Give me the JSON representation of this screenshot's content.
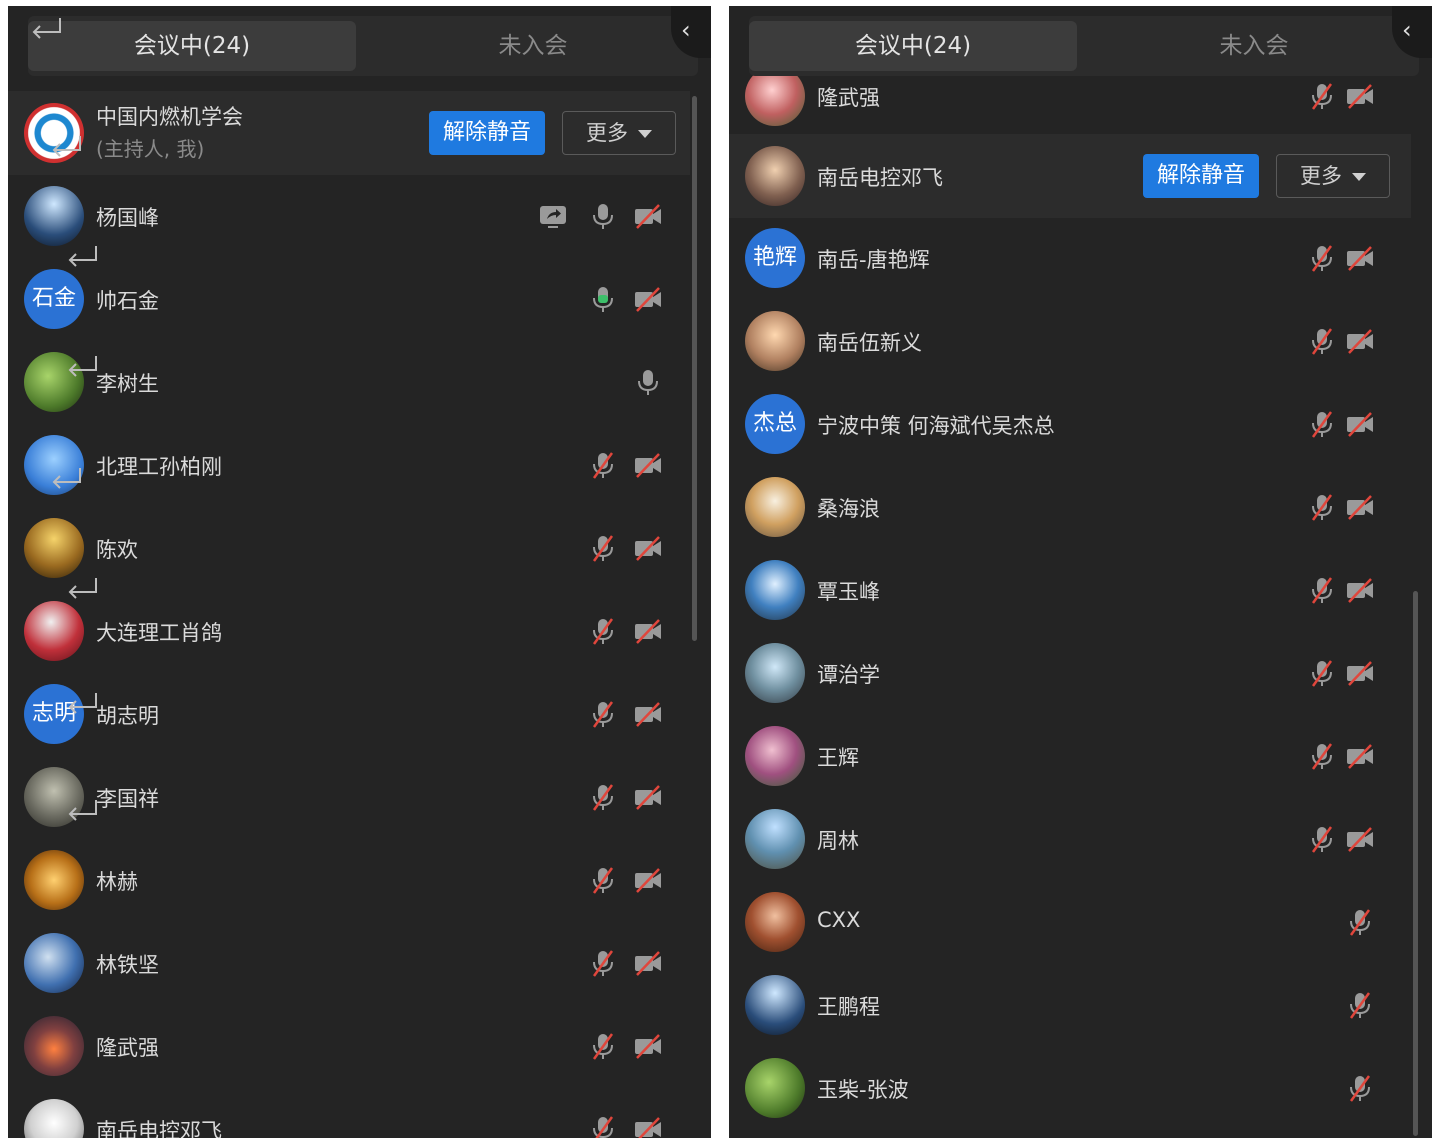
{
  "left_panel": {
    "tabs": [
      {
        "label": "会议中(24)"
      },
      {
        "label": "未入会"
      }
    ],
    "collapse_glyph": "‹",
    "host_row": {
      "name": "中国内燃机学会",
      "role": "(主持人, 我)",
      "unmute_label": "解除静音",
      "more_label": "更多"
    },
    "participants": [
      {
        "name": "杨国峰",
        "mic": "normal",
        "cam": "off",
        "share": true
      },
      {
        "name": "帅石金",
        "avatar_text": "石金",
        "mic": "speaking",
        "cam": "off"
      },
      {
        "name": "李树生",
        "mic": "normal",
        "cam": "none"
      },
      {
        "name": "北理工孙柏刚",
        "mic": "muted",
        "cam": "off"
      },
      {
        "name": "陈欢",
        "mic": "muted",
        "cam": "off"
      },
      {
        "name": "大连理工肖鸽",
        "mic": "muted",
        "cam": "off"
      },
      {
        "name": "胡志明",
        "avatar_text": "志明",
        "mic": "muted",
        "cam": "off"
      },
      {
        "name": "李国祥",
        "mic": "muted",
        "cam": "off"
      },
      {
        "name": "林赫",
        "mic": "muted",
        "cam": "off"
      },
      {
        "name": "林铁坚",
        "mic": "muted",
        "cam": "off"
      },
      {
        "name": "隆武强",
        "mic": "muted",
        "cam": "off"
      },
      {
        "name": "南岳电控邓飞",
        "mic": "muted",
        "cam": "off"
      }
    ]
  },
  "right_panel": {
    "tabs": [
      {
        "label": "会议中(24)"
      },
      {
        "label": "未入会"
      }
    ],
    "collapse_glyph": "‹",
    "partial_top": {
      "name": "隆武强"
    },
    "host_row": {
      "name": "南岳电控邓飞",
      "unmute_label": "解除静音",
      "more_label": "更多"
    },
    "participants": [
      {
        "name": "南岳-唐艳辉",
        "avatar_text": "艳辉",
        "mic": "muted",
        "cam": "off"
      },
      {
        "name": "南岳伍新义",
        "mic": "muted",
        "cam": "off"
      },
      {
        "name": "宁波中策 何海斌代吴杰总",
        "avatar_text": "杰总",
        "mic": "muted",
        "cam": "off"
      },
      {
        "name": "桑海浪",
        "mic": "muted",
        "cam": "off"
      },
      {
        "name": "覃玉峰",
        "mic": "muted",
        "cam": "off"
      },
      {
        "name": "谭治学",
        "mic": "muted",
        "cam": "off"
      },
      {
        "name": "王辉",
        "mic": "muted",
        "cam": "off"
      },
      {
        "name": "周林",
        "mic": "muted",
        "cam": "off"
      },
      {
        "name": "CXX",
        "mic": "muted",
        "cam": "none"
      },
      {
        "name": "王鹏程",
        "mic": "muted",
        "cam": "none"
      },
      {
        "name": "玉柴-张波",
        "mic": "muted",
        "cam": "none"
      }
    ]
  },
  "colors": {
    "panel_bg": "#242424",
    "accent_blue": "#1f7ae0",
    "speaking_green": "#3dbf6a",
    "muted_red": "#e0463c"
  },
  "icons": {
    "mic": "microphone-icon",
    "mic_muted": "microphone-muted-icon",
    "cam_off": "camera-off-icon",
    "share": "screen-share-icon",
    "collapse": "chevron-left-icon"
  }
}
